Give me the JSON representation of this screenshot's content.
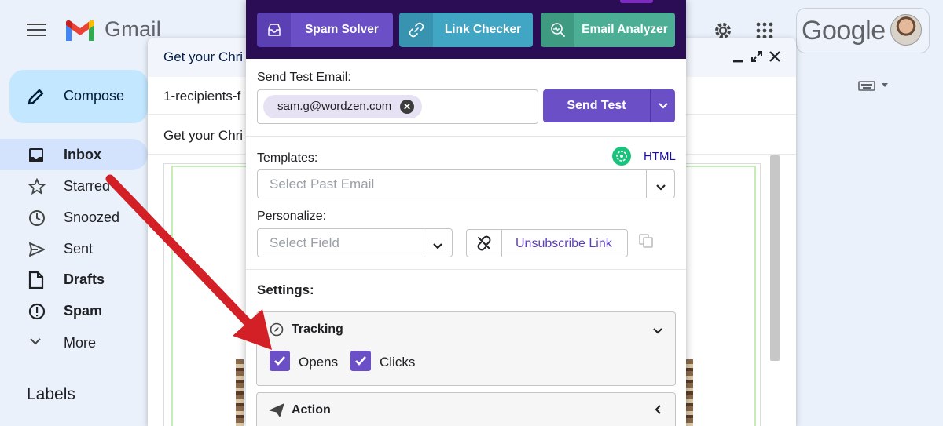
{
  "gmail": {
    "brand": "Gmail",
    "google_brand": "Google",
    "compose_label": "Compose",
    "nav": [
      {
        "label": "Inbox",
        "icon": "inbox-icon",
        "bold": true
      },
      {
        "label": "Starred",
        "icon": "star-icon",
        "bold": false
      },
      {
        "label": "Snoozed",
        "icon": "clock-icon",
        "bold": false
      },
      {
        "label": "Sent",
        "icon": "send-icon",
        "bold": false
      },
      {
        "label": "Drafts",
        "icon": "draft-icon",
        "bold": true
      },
      {
        "label": "Spam",
        "icon": "spam-icon",
        "bold": true
      },
      {
        "label": "More",
        "icon": "chevron-down-icon",
        "bold": false
      }
    ],
    "labels_title": "Labels"
  },
  "compose_window": {
    "title": "Get your Chri",
    "recipients": "1-recipients-f",
    "subject": "Get your Chri"
  },
  "panel": {
    "tools": [
      {
        "label": "Spam Solver",
        "icon": "inbox-tray-icon",
        "color": "#6b4fc6",
        "icon_bg": "#5b40b4"
      },
      {
        "label": "Link Checker",
        "icon": "link-icon",
        "color": "#41a6c4",
        "icon_bg": "#3893b0"
      },
      {
        "label": "Email Analyzer",
        "icon": "analyze-icon",
        "color": "#4caf95",
        "icon_bg": "#3f9a82"
      }
    ],
    "send_test_label": "Send Test Email:",
    "test_email": "sam.g@wordzen.com",
    "send_button": "Send Test",
    "templates_label": "Templates:",
    "html_link": "HTML",
    "templates_placeholder": "Select Past Email",
    "personalize_label": "Personalize:",
    "field_placeholder": "Select Field",
    "unsubscribe_label": "Unsubscribe Link",
    "settings_label": "Settings:",
    "tracking": {
      "title": "Tracking",
      "options": [
        {
          "label": "Opens",
          "checked": true
        },
        {
          "label": "Clicks",
          "checked": true
        }
      ]
    },
    "action_title": "Action"
  }
}
